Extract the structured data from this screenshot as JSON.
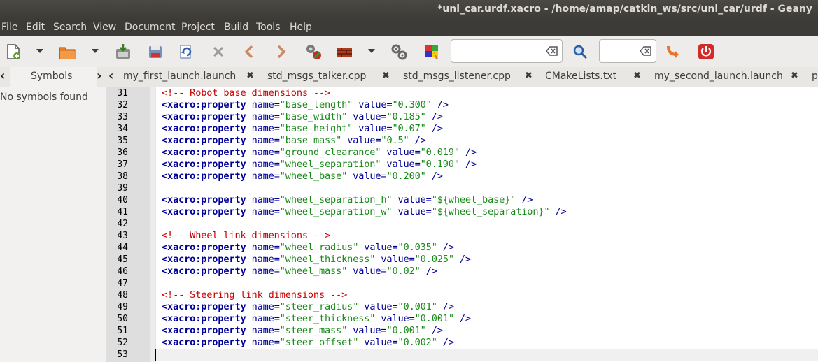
{
  "window": {
    "title": "*uni_car.urdf.xacro - /home/amap/catkin_ws/src/uni_car/urdf - Geany"
  },
  "menu": [
    "File",
    "Edit",
    "Search",
    "View",
    "Document",
    "Project",
    "Build",
    "Tools",
    "Help"
  ],
  "toolbar": {
    "search_value": "",
    "goto_value": "",
    "icons": [
      "new-file-icon",
      "open-file-icon",
      "save-icon",
      "save-all-icon",
      "revert-icon",
      "close-icon",
      "back-icon",
      "forward-icon",
      "compile-icon",
      "build-icon",
      "preferences-icon",
      "color-chooser-icon",
      "search-icon",
      "goto-line-icon",
      "quit-icon"
    ]
  },
  "sidebar": {
    "tab_label": "Symbols",
    "empty_text": "No symbols found"
  },
  "tabs": [
    {
      "label": "my_first_launch.launch"
    },
    {
      "label": "std_msgs_talker.cpp"
    },
    {
      "label": "std_msgs_listener.cpp"
    },
    {
      "label": "CMakeLists.txt"
    },
    {
      "label": "my_second_launch.launch"
    },
    {
      "label": "p"
    }
  ],
  "editor": {
    "lines": [
      {
        "n": "31",
        "tokens": [
          [
            "cmt",
            "<!-- Robot base dimensions -->"
          ]
        ]
      },
      {
        "n": "32",
        "tokens": [
          [
            "tag",
            "<xacro:property"
          ],
          [
            "pun",
            " "
          ],
          [
            "attr",
            "name"
          ],
          [
            "pun",
            "="
          ],
          [
            "val",
            "\"base_length\""
          ],
          [
            "pun",
            " "
          ],
          [
            "attr",
            "value"
          ],
          [
            "pun",
            "="
          ],
          [
            "val",
            "\"0.300\""
          ],
          [
            "pun",
            " />"
          ]
        ]
      },
      {
        "n": "33",
        "tokens": [
          [
            "tag",
            "<xacro:property"
          ],
          [
            "pun",
            " "
          ],
          [
            "attr",
            "name"
          ],
          [
            "pun",
            "="
          ],
          [
            "val",
            "\"base_width\""
          ],
          [
            "pun",
            " "
          ],
          [
            "attr",
            "value"
          ],
          [
            "pun",
            "="
          ],
          [
            "val",
            "\"0.185\""
          ],
          [
            "pun",
            " />"
          ]
        ]
      },
      {
        "n": "34",
        "tokens": [
          [
            "tag",
            "<xacro:property"
          ],
          [
            "pun",
            " "
          ],
          [
            "attr",
            "name"
          ],
          [
            "pun",
            "="
          ],
          [
            "val",
            "\"base_height\""
          ],
          [
            "pun",
            " "
          ],
          [
            "attr",
            "value"
          ],
          [
            "pun",
            "="
          ],
          [
            "val",
            "\"0.07\""
          ],
          [
            "pun",
            " />"
          ]
        ]
      },
      {
        "n": "35",
        "tokens": [
          [
            "tag",
            "<xacro:property"
          ],
          [
            "pun",
            " "
          ],
          [
            "attr",
            "name"
          ],
          [
            "pun",
            "="
          ],
          [
            "val",
            "\"base_mass\""
          ],
          [
            "pun",
            " "
          ],
          [
            "attr",
            "value"
          ],
          [
            "pun",
            "="
          ],
          [
            "val",
            "\"0.5\""
          ],
          [
            "pun",
            " />"
          ]
        ]
      },
      {
        "n": "36",
        "tokens": [
          [
            "tag",
            "<xacro:property"
          ],
          [
            "pun",
            " "
          ],
          [
            "attr",
            "name"
          ],
          [
            "pun",
            "="
          ],
          [
            "val",
            "\"ground_clearance\""
          ],
          [
            "pun",
            " "
          ],
          [
            "attr",
            "value"
          ],
          [
            "pun",
            "="
          ],
          [
            "val",
            "\"0.019\""
          ],
          [
            "pun",
            " />"
          ]
        ]
      },
      {
        "n": "37",
        "tokens": [
          [
            "tag",
            "<xacro:property"
          ],
          [
            "pun",
            " "
          ],
          [
            "attr",
            "name"
          ],
          [
            "pun",
            "="
          ],
          [
            "val",
            "\"wheel_separation\""
          ],
          [
            "pun",
            " "
          ],
          [
            "attr",
            "value"
          ],
          [
            "pun",
            "="
          ],
          [
            "val",
            "\"0.190\""
          ],
          [
            "pun",
            " />"
          ]
        ]
      },
      {
        "n": "38",
        "tokens": [
          [
            "tag",
            "<xacro:property"
          ],
          [
            "pun",
            " "
          ],
          [
            "attr",
            "name"
          ],
          [
            "pun",
            "="
          ],
          [
            "val",
            "\"wheel_base\""
          ],
          [
            "pun",
            " "
          ],
          [
            "attr",
            "value"
          ],
          [
            "pun",
            "="
          ],
          [
            "val",
            "\"0.200\""
          ],
          [
            "pun",
            " />"
          ]
        ]
      },
      {
        "n": "39",
        "tokens": []
      },
      {
        "n": "40",
        "tokens": [
          [
            "tag",
            "<xacro:property"
          ],
          [
            "pun",
            " "
          ],
          [
            "attr",
            "name"
          ],
          [
            "pun",
            "="
          ],
          [
            "val",
            "\"wheel_separation_h\""
          ],
          [
            "pun",
            " "
          ],
          [
            "attr",
            "value"
          ],
          [
            "pun",
            "="
          ],
          [
            "val",
            "\"${wheel_base}\""
          ],
          [
            "pun",
            " />"
          ]
        ]
      },
      {
        "n": "41",
        "tokens": [
          [
            "tag",
            "<xacro:property"
          ],
          [
            "pun",
            " "
          ],
          [
            "attr",
            "name"
          ],
          [
            "pun",
            "="
          ],
          [
            "val",
            "\"wheel_separation_w\""
          ],
          [
            "pun",
            " "
          ],
          [
            "attr",
            "value"
          ],
          [
            "pun",
            "="
          ],
          [
            "val",
            "\"${wheel_separation}\""
          ],
          [
            "pun",
            " />"
          ]
        ]
      },
      {
        "n": "42",
        "tokens": []
      },
      {
        "n": "43",
        "tokens": [
          [
            "cmt",
            "<!-- Wheel link dimensions -->"
          ]
        ]
      },
      {
        "n": "44",
        "tokens": [
          [
            "tag",
            "<xacro:property"
          ],
          [
            "pun",
            " "
          ],
          [
            "attr",
            "name"
          ],
          [
            "pun",
            "="
          ],
          [
            "val",
            "\"wheel_radius\""
          ],
          [
            "pun",
            " "
          ],
          [
            "attr",
            "value"
          ],
          [
            "pun",
            "="
          ],
          [
            "val",
            "\"0.035\""
          ],
          [
            "pun",
            " />"
          ]
        ]
      },
      {
        "n": "45",
        "tokens": [
          [
            "tag",
            "<xacro:property"
          ],
          [
            "pun",
            " "
          ],
          [
            "attr",
            "name"
          ],
          [
            "pun",
            "="
          ],
          [
            "val",
            "\"wheel_thickness\""
          ],
          [
            "pun",
            " "
          ],
          [
            "attr",
            "value"
          ],
          [
            "pun",
            "="
          ],
          [
            "val",
            "\"0.025\""
          ],
          [
            "pun",
            " />"
          ]
        ]
      },
      {
        "n": "46",
        "tokens": [
          [
            "tag",
            "<xacro:property"
          ],
          [
            "pun",
            " "
          ],
          [
            "attr",
            "name"
          ],
          [
            "pun",
            "="
          ],
          [
            "val",
            "\"wheel_mass\""
          ],
          [
            "pun",
            " "
          ],
          [
            "attr",
            "value"
          ],
          [
            "pun",
            "="
          ],
          [
            "val",
            "\"0.02\""
          ],
          [
            "pun",
            " />"
          ]
        ]
      },
      {
        "n": "47",
        "tokens": []
      },
      {
        "n": "48",
        "tokens": [
          [
            "cmt",
            "<!-- Steering link dimensions -->"
          ]
        ]
      },
      {
        "n": "49",
        "tokens": [
          [
            "tag",
            "<xacro:property"
          ],
          [
            "pun",
            " "
          ],
          [
            "attr",
            "name"
          ],
          [
            "pun",
            "="
          ],
          [
            "val",
            "\"steer_radius\""
          ],
          [
            "pun",
            " "
          ],
          [
            "attr",
            "value"
          ],
          [
            "pun",
            "="
          ],
          [
            "val",
            "\"0.001\""
          ],
          [
            "pun",
            " />"
          ]
        ]
      },
      {
        "n": "50",
        "tokens": [
          [
            "tag",
            "<xacro:property"
          ],
          [
            "pun",
            " "
          ],
          [
            "attr",
            "name"
          ],
          [
            "pun",
            "="
          ],
          [
            "val",
            "\"steer_thickness\""
          ],
          [
            "pun",
            " "
          ],
          [
            "attr",
            "value"
          ],
          [
            "pun",
            "="
          ],
          [
            "val",
            "\"0.001\""
          ],
          [
            "pun",
            " />"
          ]
        ]
      },
      {
        "n": "51",
        "tokens": [
          [
            "tag",
            "<xacro:property"
          ],
          [
            "pun",
            " "
          ],
          [
            "attr",
            "name"
          ],
          [
            "pun",
            "="
          ],
          [
            "val",
            "\"steer_mass\""
          ],
          [
            "pun",
            " "
          ],
          [
            "attr",
            "value"
          ],
          [
            "pun",
            "="
          ],
          [
            "val",
            "\"0.001\""
          ],
          [
            "pun",
            " />"
          ]
        ]
      },
      {
        "n": "52",
        "tokens": [
          [
            "tag",
            "<xacro:property"
          ],
          [
            "pun",
            " "
          ],
          [
            "attr",
            "name"
          ],
          [
            "pun",
            "="
          ],
          [
            "val",
            "\"steer_offset\""
          ],
          [
            "pun",
            " "
          ],
          [
            "attr",
            "value"
          ],
          [
            "pun",
            "="
          ],
          [
            "val",
            "\"0.002\""
          ],
          [
            "pun",
            " />"
          ]
        ]
      },
      {
        "n": "53",
        "tokens": []
      }
    ]
  }
}
